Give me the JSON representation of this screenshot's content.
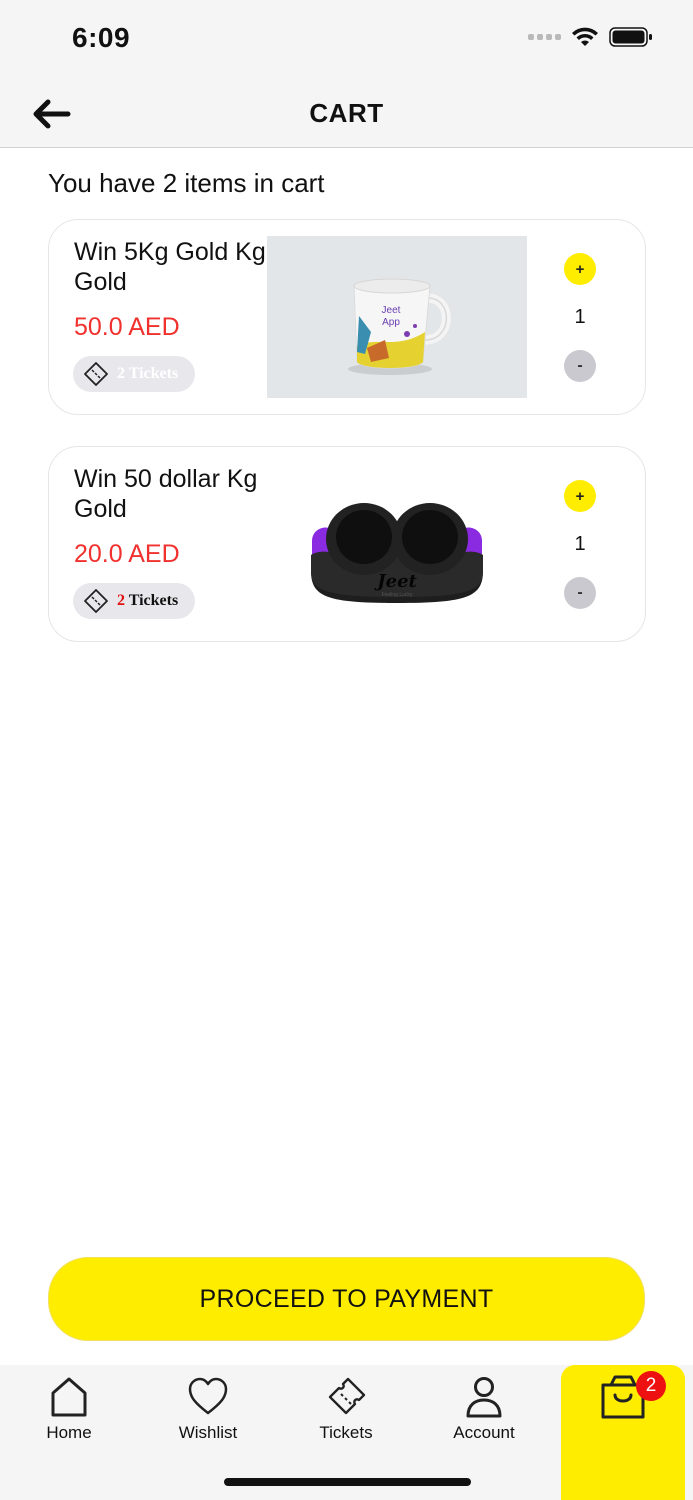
{
  "status_bar": {
    "time": "6:09"
  },
  "header": {
    "title": "CART"
  },
  "cart_summary": "You have 2 items in cart",
  "items": [
    {
      "title": "Win 5Kg Gold Kg Gold",
      "price": "50.0 AED",
      "tickets_count": "2",
      "tickets_label": "Tickets",
      "image": "mug-image",
      "image_text": "Jeet App",
      "quantity": "1",
      "plus_label": "+",
      "minus_label": "-"
    },
    {
      "title": "Win 50 dollar Kg Gold",
      "price": "20.0 AED",
      "tickets_count": "2",
      "tickets_label": "Tickets",
      "image": "headphones-image",
      "image_text": "Jeet",
      "image_subtext": "Feeling Lucky",
      "quantity": "1",
      "plus_label": "+",
      "minus_label": "-"
    }
  ],
  "payment_button_label": "PROCEED TO PAYMENT",
  "tab_bar": {
    "home": "Home",
    "wishlist": "Wishlist",
    "tickets": "Tickets",
    "account": "Account",
    "cart_badge": "2"
  },
  "colors": {
    "accent": "#ffed00",
    "price": "#f0312e",
    "badge": "#ee1111"
  }
}
